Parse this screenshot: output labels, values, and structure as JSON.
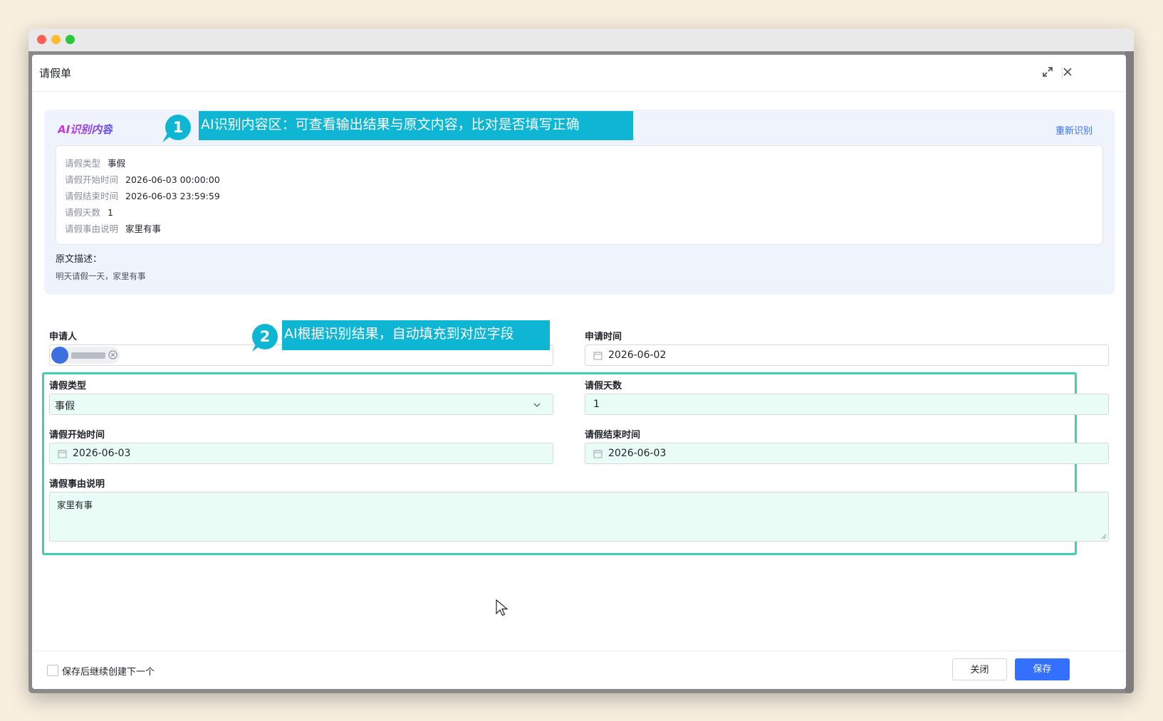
{
  "modal": {
    "title": "请假单"
  },
  "ai_panel": {
    "title": "AI识别内容",
    "retry_label": "重新识别",
    "rows": [
      {
        "key": "请假类型",
        "value": "事假"
      },
      {
        "key": "请假开始时间",
        "value": "2026-06-03 00:00:00"
      },
      {
        "key": "请假结束时间",
        "value": "2026-06-03 23:59:59"
      },
      {
        "key": "请假天数",
        "value": "1"
      },
      {
        "key": "请假事由说明",
        "value": "家里有事"
      }
    ],
    "original_label": "原文描述：",
    "original_text": "明天请假一天，家里有事"
  },
  "form": {
    "applicant_label": "申请人",
    "apply_time_label": "申请时间",
    "apply_time_value": "2026-06-02",
    "leave_type_label": "请假类型",
    "leave_type_value": "事假",
    "days_label": "请假天数",
    "days_value": "1",
    "start_label": "请假开始时间",
    "start_value": "2026-06-03",
    "end_label": "请假结束时间",
    "end_value": "2026-06-03",
    "reason_label": "请假事由说明",
    "reason_value": "家里有事"
  },
  "annotations": {
    "callout1_num": "1",
    "callout1_text": "AI识别内容区：可查看输出结果与原文内容，比对是否填写正确",
    "callout2_num": "2",
    "callout2_text": "AI根据识别结果，自动填充到对应字段"
  },
  "footer": {
    "continue_label": "保存后继续创建下一个",
    "close_label": "关闭",
    "save_label": "保存"
  },
  "colors": {
    "primary": "#3370ff",
    "callout": "#0fb6d4",
    "highlight_border": "#3bd1b1",
    "highlight_fill": "#e9fcf5"
  }
}
